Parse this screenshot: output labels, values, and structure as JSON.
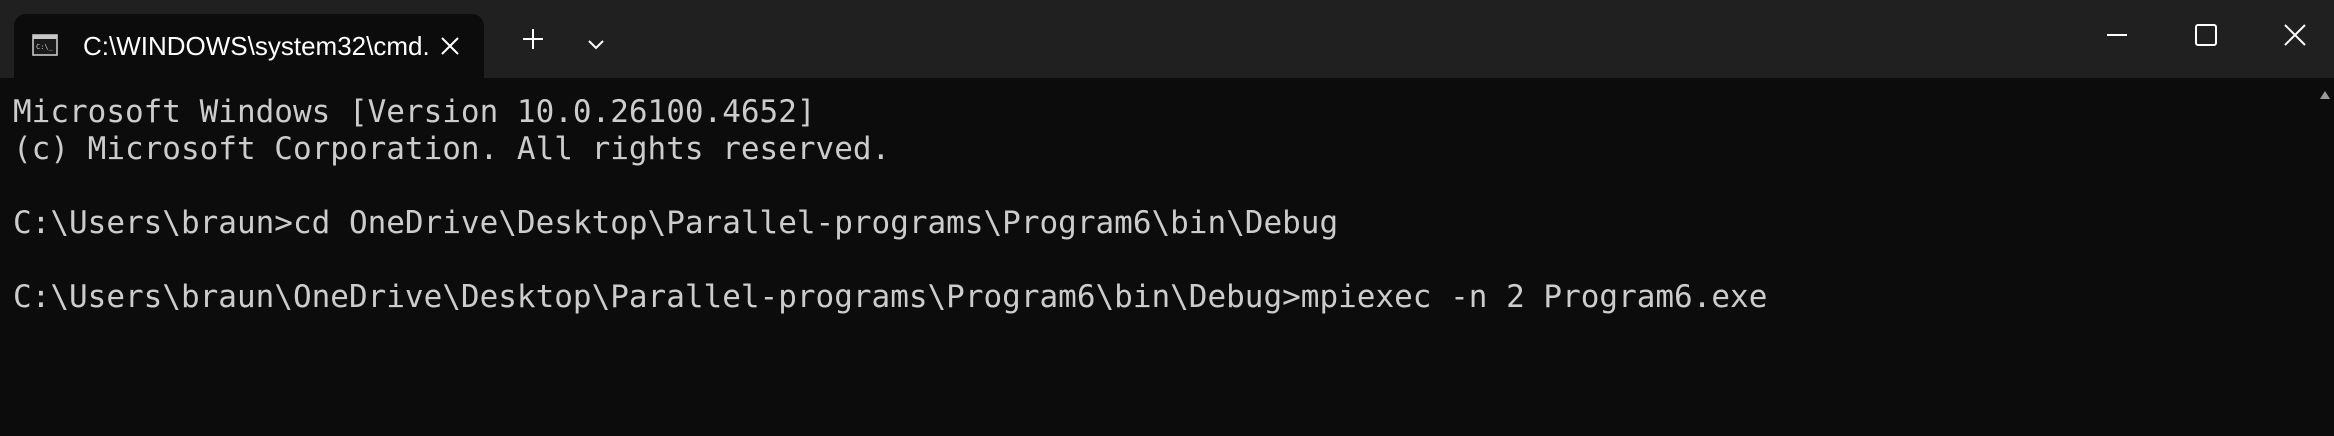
{
  "tab": {
    "icon": "terminal-icon",
    "title": "C:\\WINDOWS\\system32\\cmd."
  },
  "titlebar": {
    "new_tab_icon": "plus-icon",
    "dropdown_icon": "chevron-down-icon",
    "minimize_icon": "minimize-icon",
    "maximize_icon": "maximize-icon",
    "close_icon": "close-icon"
  },
  "console": {
    "lines": [
      "Microsoft Windows [Version 10.0.26100.4652]",
      "(c) Microsoft Corporation. All rights reserved.",
      "",
      "C:\\Users\\braun>cd OneDrive\\Desktop\\Parallel-programs\\Program6\\bin\\Debug",
      "",
      "C:\\Users\\braun\\OneDrive\\Desktop\\Parallel-programs\\Program6\\bin\\Debug>mpiexec -n 2 Program6.exe"
    ]
  },
  "colors": {
    "background": "#0c0c0c",
    "titlebar": "#202020",
    "text": "#cccccc",
    "tab_text": "#ffffff"
  }
}
